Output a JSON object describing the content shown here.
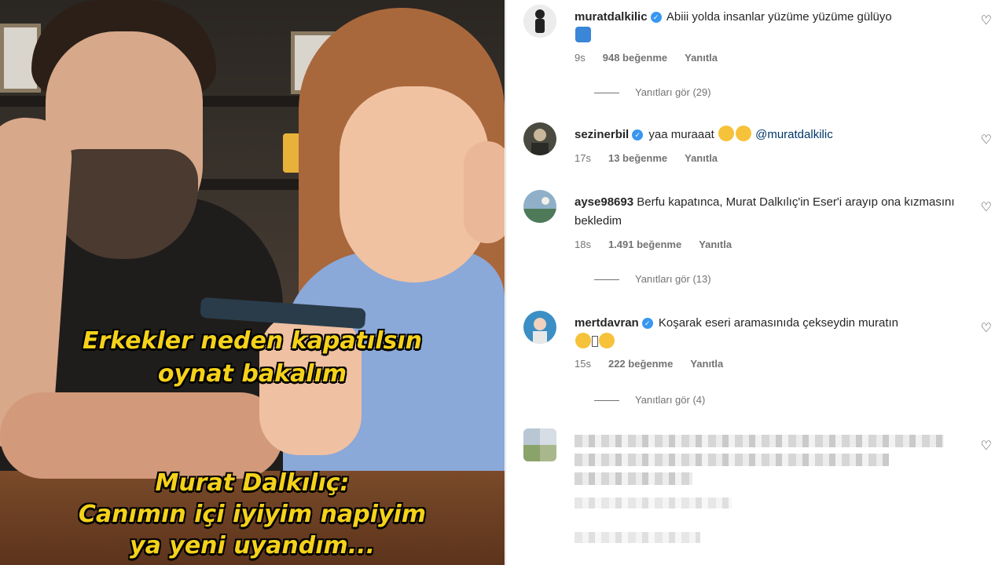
{
  "video": {
    "caption_line1": "Erkekler neden kapatılsın",
    "caption_line2": "oynat bakalım",
    "caption_line3": "Murat Dalkılıç:",
    "caption_line4": "Canımın içi iyiyim napiyim",
    "caption_line5": "ya yeni uyandım..."
  },
  "comments": [
    {
      "username": "muratdalkilic",
      "verified": true,
      "text": "Abiii yolda insanlar yüzüme yüzüme gülüyo",
      "time": "9s",
      "likes": "948 beğenme",
      "reply_label": "Yanıtla",
      "view_replies": "Yanıtları gör (29)"
    },
    {
      "username": "sezinerbil",
      "verified": true,
      "text": "yaa muraaat",
      "mention": "@muratdalkilic",
      "time": "17s",
      "likes": "13 beğenme",
      "reply_label": "Yanıtla"
    },
    {
      "username": "ayse98693",
      "verified": false,
      "text": "Berfu kapatınca, Murat Dalkılıç'in Eser'i arayıp ona kızmasını bekledim",
      "time": "18s",
      "likes": "1.491 beğenme",
      "reply_label": "Yanıtla",
      "view_replies": "Yanıtları gör (13)"
    },
    {
      "username": "mertdavran",
      "verified": true,
      "text": "Koşarak eseri aramasınıda çekseydin muratın",
      "time": "15s",
      "likes": "222 beğenme",
      "reply_label": "Yanıtla",
      "view_replies": "Yanıtları gör (4)"
    }
  ],
  "icons": {
    "like": "heart-outline-icon",
    "verified": "verified-badge-icon"
  },
  "colors": {
    "caption": "#f5d21a",
    "verified": "#3897f0",
    "meta": "#737373",
    "mention": "#00376b"
  }
}
